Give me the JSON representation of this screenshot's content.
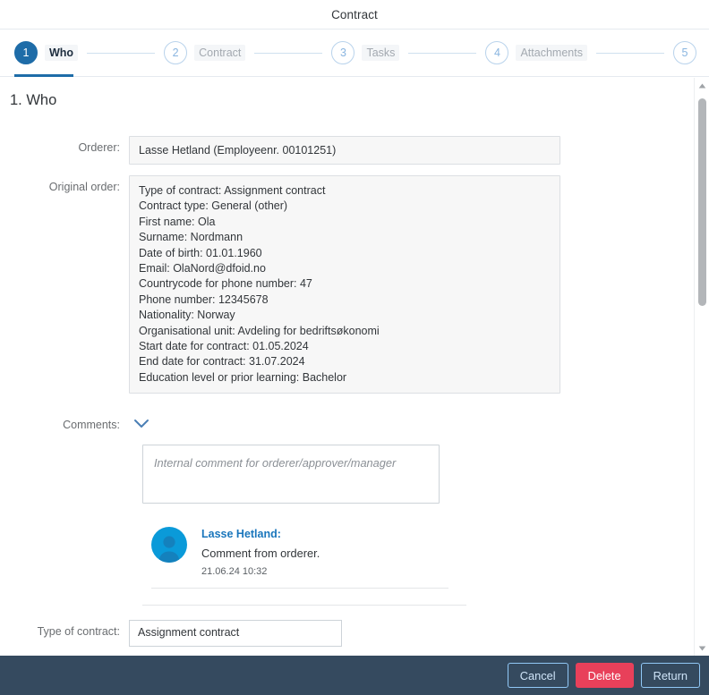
{
  "header": {
    "title": "Contract"
  },
  "wizard": {
    "steps": [
      {
        "number": "1",
        "label": "Who",
        "active": true
      },
      {
        "number": "2",
        "label": "Contract",
        "active": false
      },
      {
        "number": "3",
        "label": "Tasks",
        "active": false
      },
      {
        "number": "4",
        "label": "Attachments",
        "active": false
      },
      {
        "number": "5",
        "label": "",
        "active": false
      }
    ]
  },
  "main": {
    "section_title": "1. Who",
    "orderer": {
      "label": "Orderer:",
      "value": "Lasse Hetland (Employeenr. 00101251)"
    },
    "original_order": {
      "label": "Original order:",
      "lines": [
        "Type of contract: Assignment contract",
        "Contract type: General (other)",
        "First name: Ola",
        "Surname: Nordmann",
        "Date of birth: 01.01.1960",
        "Email: OlaNord@dfoid.no",
        "Countrycode for phone number: 47",
        "Phone number: 12345678",
        "Nationality: Norway",
        "Organisational unit: Avdeling for bedriftsøkonomi",
        "Start date for contract: 01.05.2024",
        "End date for contract: 31.07.2024",
        "Education level or prior learning: Bachelor"
      ]
    },
    "comments": {
      "label": "Comments:",
      "toggle_icon": "chevron-down-icon",
      "input_placeholder": "Internal comment for orderer/approver/manager",
      "input_value": "",
      "entries": [
        {
          "author": "Lasse Hetland:",
          "text": "Comment from orderer.",
          "timestamp": "21.06.24 10:32",
          "avatar_icon": "person-icon"
        }
      ]
    },
    "clipped_row": {
      "label": "Type of contract:",
      "value": "Assignment contract"
    }
  },
  "scrollbar": {
    "up_icon": "caret-up-icon",
    "down_icon": "caret-down-icon"
  },
  "footer": {
    "buttons": [
      {
        "label": "Cancel",
        "style": "ghost"
      },
      {
        "label": "Delete",
        "style": "danger"
      },
      {
        "label": "Return",
        "style": "ghost"
      }
    ]
  },
  "colors": {
    "active_step": "#1e6ca8",
    "footer_bg": "#354a5f",
    "delete_button": "#e8405a",
    "avatar_bg": "#0a9ad9",
    "author_link": "#1a76bc"
  }
}
